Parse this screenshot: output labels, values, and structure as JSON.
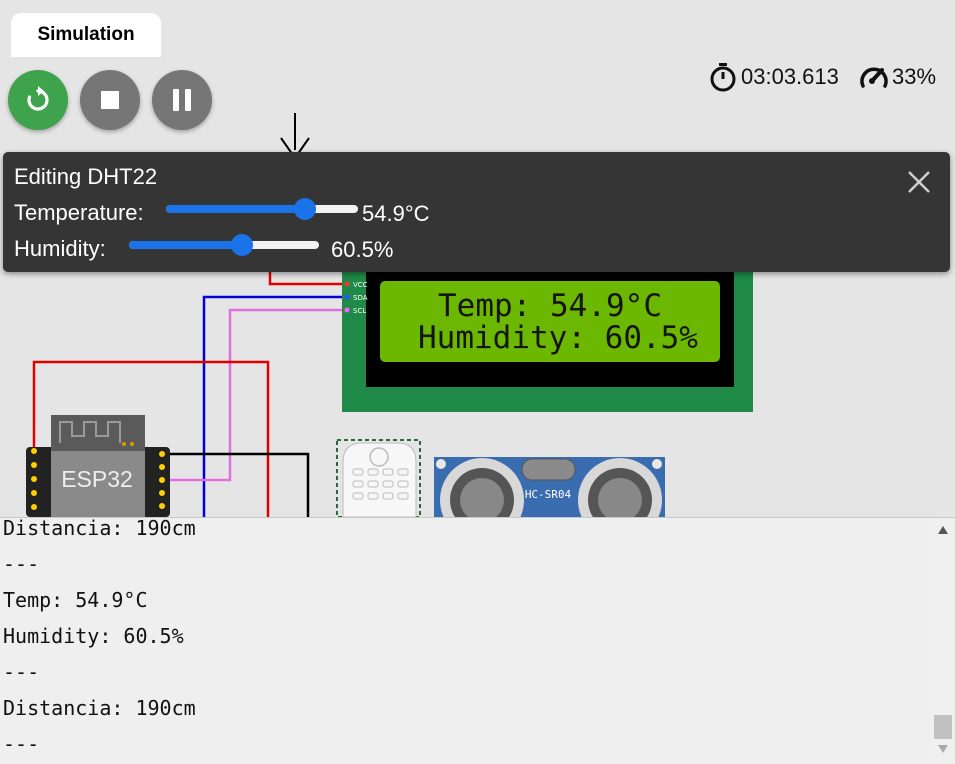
{
  "tab": {
    "label": "Simulation"
  },
  "controls": {
    "restart_icon": "restart-icon",
    "stop_icon": "stop-icon",
    "pause_icon": "pause-icon"
  },
  "status": {
    "timer": "03:03.613",
    "speed": "33%"
  },
  "editor": {
    "title": "Editing DHT22",
    "temperature_label": "Temperature:",
    "temperature_value": "54.9°C",
    "temperature_fraction": 0.75,
    "humidity_label": "Humidity:",
    "humidity_value": "60.5%",
    "humidity_fraction": 0.605
  },
  "circuit": {
    "lcd_line1": "Temp: 54.9°C",
    "lcd_line2": "Humidity: 60.5%",
    "lcd_pins": [
      "VCC",
      "SDA",
      "SCL"
    ],
    "mcu_label": "ESP32",
    "ultrasonic_label": "HC-SR04",
    "colors": {
      "board_green": "#1f8a48",
      "lcd_green": "#6cb800",
      "wire_red": "#e00000",
      "wire_blue": "#0000d0",
      "wire_pink": "#e070e0",
      "ultrasonic_blue": "#3a6db0"
    }
  },
  "console": {
    "lines": [
      "Distancia: 190cm",
      "---",
      "Temp: 54.9°C",
      "Humidity: 60.5%",
      "---",
      "Distancia: 190cm",
      "---"
    ]
  }
}
